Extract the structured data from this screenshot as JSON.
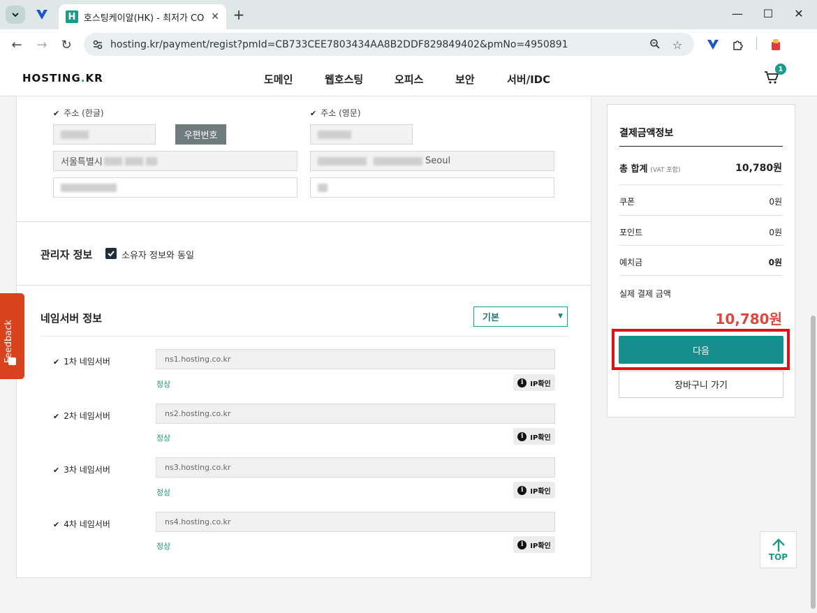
{
  "browser": {
    "tab_title": "호스팅케이알(HK) - 최저가 CO",
    "new_tab": "+",
    "url": "hosting.kr/payment/regist?pmId=CB733CEE7803434AA8B2DDF829849402&pmNo=4950891"
  },
  "header": {
    "logo": "HOSTING",
    "logo_dot": ".",
    "logo_suffix": "KR",
    "nav": [
      "도메인",
      "웹호스팅",
      "오피스",
      "보안",
      "서버/IDC"
    ],
    "cart_count": "1"
  },
  "address": {
    "kr_label": "주소 (한글)",
    "en_label": "주소 (영문)",
    "zip_button": "우편번호",
    "kr_line1_prefix": "서울특별시",
    "en_line1_suffix": "Seoul"
  },
  "admin": {
    "title": "관리자 정보",
    "same_as_owner": "소유자 정보와 동일"
  },
  "nameserver": {
    "title": "네임서버 정보",
    "select_value": "기본",
    "rows": [
      {
        "label": "1차 네임서버",
        "value": "ns1.hosting.co.kr",
        "status": "정상",
        "check": "IP확인"
      },
      {
        "label": "2차 네임서버",
        "value": "ns2.hosting.co.kr",
        "status": "정상",
        "check": "IP확인"
      },
      {
        "label": "3차 네임서버",
        "value": "ns3.hosting.co.kr",
        "status": "정상",
        "check": "IP확인"
      },
      {
        "label": "4차 네임서버",
        "value": "ns4.hosting.co.kr",
        "status": "정상",
        "check": "IP확인"
      }
    ]
  },
  "feedback": "Feedback",
  "summary": {
    "title": "결제금액정보",
    "total_label": "총 합계",
    "vat_note": "(VAT 포함)",
    "total_value": "10,780원",
    "coupon_label": "쿠폰",
    "coupon_value": "0원",
    "point_label": "포인트",
    "point_value": "0원",
    "deposit_label": "예치금",
    "deposit_value": "0원",
    "actual_label": "실제 결제 금액",
    "actual_value": "10,780원",
    "next_button": "다음",
    "cart_button": "장바구니 가기"
  },
  "top_button": "TOP",
  "colors": {
    "brand": "#1c9a8a",
    "highlight": "#e10f17",
    "price": "#e0483d",
    "feedback": "#d8431e"
  }
}
